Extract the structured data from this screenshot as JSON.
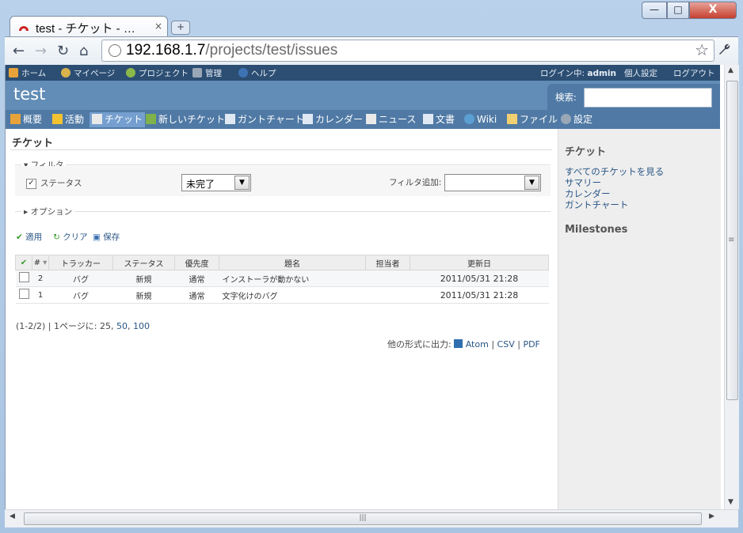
{
  "browser": {
    "tab_title": "test - チケット - …",
    "tab_close": "×",
    "new_tab": "+",
    "window_buttons": {
      "minimize": "—",
      "maximize": "□",
      "close": "X"
    },
    "url_host": "192.168.1.7",
    "url_path": "/projects/test/issues",
    "nav": {
      "back": "←",
      "forward": "→",
      "reload": "↻",
      "home": "⌂",
      "star": "☆",
      "wrench": "🔧"
    }
  },
  "top_menu": {
    "items": [
      "ホーム",
      "マイページ",
      "プロジェクト",
      "管理",
      "ヘルプ"
    ],
    "logged_in_label": "ログイン中:",
    "user": "admin",
    "my_account": "個人設定",
    "logout": "ログアウト"
  },
  "header": {
    "project": "test",
    "search_label": "検索:",
    "search_value": ""
  },
  "main_menu": [
    "概要",
    "活動",
    "チケット",
    "新しいチケット",
    "ガントチャート",
    "カレンダー",
    "ニュース",
    "文書",
    "Wiki",
    "ファイル",
    "設定"
  ],
  "page": {
    "title": "チケット",
    "filter_legend": "フィルタ",
    "status_label": "ステータス",
    "status_operator": "未完了",
    "add_filter_label": "フィルタ追加:",
    "add_filter_value": "",
    "options_legend": "オプション",
    "actions": {
      "apply": "適用",
      "clear": "クリア",
      "save": "保存"
    },
    "columns": [
      "#",
      "トラッカー",
      "ステータス",
      "優先度",
      "題名",
      "担当者",
      "更新日"
    ],
    "issues": [
      {
        "id": "2",
        "tracker": "バグ",
        "status": "新規",
        "priority": "通常",
        "subject": "インストーラが動かない",
        "assignee": "",
        "updated": "2011/05/31 21:28"
      },
      {
        "id": "1",
        "tracker": "バグ",
        "status": "新規",
        "priority": "通常",
        "subject": "文字化けのバグ",
        "assignee": "",
        "updated": "2011/05/31 21:28"
      }
    ],
    "pagination": {
      "count": "(1-2/2)",
      "per_page_label": "| 1ページに:",
      "sizes": [
        "25",
        "50",
        "100"
      ]
    },
    "export": {
      "label": "他の形式に出力:",
      "formats": [
        "Atom",
        "CSV",
        "PDF"
      ],
      "sep": "|"
    }
  },
  "sidebar": {
    "heading": "チケット",
    "links": [
      "すべてのチケットを見る",
      "サマリー",
      "カレンダー",
      "ガントチャート"
    ],
    "milestones": "Milestones"
  },
  "colors": {
    "header": "#628db6",
    "top_menu": "#2c4e73",
    "main_menu": "#507aa5",
    "link": "#2a5685"
  }
}
